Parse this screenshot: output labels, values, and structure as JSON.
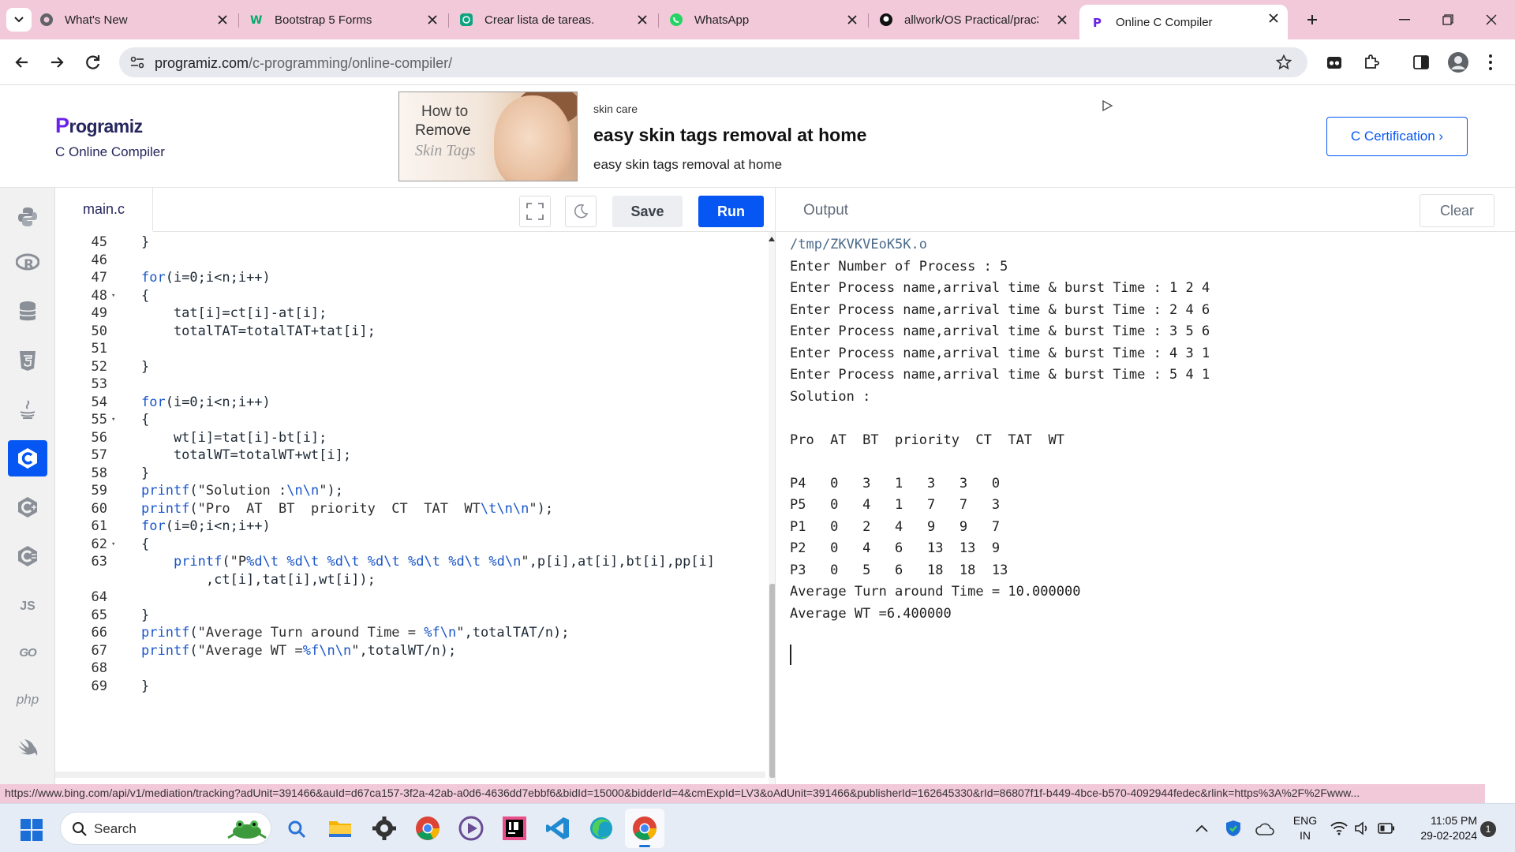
{
  "browser": {
    "tabs": [
      {
        "title": "What's New",
        "icon": "chrome-settings-icon"
      },
      {
        "title": "Bootstrap 5 Forms",
        "icon": "w3schools-icon"
      },
      {
        "title": "Crear lista de tareas.",
        "icon": "chatgpt-icon"
      },
      {
        "title": "WhatsApp",
        "icon": "whatsapp-icon"
      },
      {
        "title": "allwork/OS Practical/prac3",
        "icon": "github-icon"
      },
      {
        "title": "Online C Compiler",
        "icon": "programiz-icon"
      }
    ],
    "url_host": "programiz.com",
    "url_path": "/c-programming/online-compiler/"
  },
  "site": {
    "logo": "rogramiz",
    "logo_p": "P",
    "subtitle": "C Online Compiler",
    "certification_button": "C Certification ›"
  },
  "ad": {
    "image_line1": "How to",
    "image_line2": "Remove",
    "image_line3": "Skin Tags",
    "label": "skin care",
    "title": "easy skin tags removal at home",
    "description": "easy skin tags removal at home"
  },
  "languages": [
    "python",
    "r",
    "sql",
    "html",
    "java",
    "c",
    "cpp",
    "csharp",
    "js",
    "go",
    "php",
    "swift"
  ],
  "language_labels": {
    "js": "JS",
    "go": "GO",
    "php": "php"
  },
  "editor": {
    "filename": "main.c",
    "save_label": "Save",
    "run_label": "Run",
    "lines": [
      {
        "n": "45",
        "text": "}"
      },
      {
        "n": "46",
        "text": ""
      },
      {
        "n": "47",
        "text": "for(i=0;i<n;i++)"
      },
      {
        "n": "48",
        "text": "{",
        "fold": true
      },
      {
        "n": "49",
        "text": "    tat[i]=ct[i]-at[i];"
      },
      {
        "n": "50",
        "text": "    totalTAT=totalTAT+tat[i];"
      },
      {
        "n": "51",
        "text": ""
      },
      {
        "n": "52",
        "text": "}"
      },
      {
        "n": "53",
        "text": ""
      },
      {
        "n": "54",
        "text": "for(i=0;i<n;i++)"
      },
      {
        "n": "55",
        "text": "{",
        "fold": true
      },
      {
        "n": "56",
        "text": "    wt[i]=tat[i]-bt[i];"
      },
      {
        "n": "57",
        "text": "    totalWT=totalWT+wt[i];"
      },
      {
        "n": "58",
        "text": "}"
      },
      {
        "n": "59",
        "text": "printf(\"Solution :\\n\\n\");"
      },
      {
        "n": "60",
        "text": "printf(\"Pro  AT  BT  priority  CT  TAT  WT\\t\\n\\n\");"
      },
      {
        "n": "61",
        "text": "for(i=0;i<n;i++)"
      },
      {
        "n": "62",
        "text": "{",
        "fold": true
      },
      {
        "n": "63",
        "text": "    printf(\"P%d\\t %d\\t %d\\t %d\\t %d\\t %d\\t %d\\n\",p[i],at[i],bt[i],pp[i]"
      },
      {
        "n": "",
        "text": "        ,ct[i],tat[i],wt[i]);"
      },
      {
        "n": "64",
        "text": ""
      },
      {
        "n": "65",
        "text": "}"
      },
      {
        "n": "66",
        "text": "printf(\"Average Turn around Time = %f\\n\",totalTAT/n);"
      },
      {
        "n": "67",
        "text": "printf(\"Average WT =%f\\n\\n\",totalWT/n);"
      },
      {
        "n": "68",
        "text": ""
      },
      {
        "n": "69",
        "text": "}"
      }
    ]
  },
  "output": {
    "title": "Output",
    "clear_label": "Clear",
    "lines": [
      "/tmp/ZKVKVEoK5K.o",
      "Enter Number of Process : 5",
      "Enter Process name,arrival time & burst Time : 1 2 4",
      "Enter Process name,arrival time & burst Time : 2 4 6",
      "Enter Process name,arrival time & burst Time : 3 5 6",
      "Enter Process name,arrival time & burst Time : 4 3 1",
      "Enter Process name,arrival time & burst Time : 5 4 1",
      "Solution :",
      "",
      "Pro  AT  BT  priority  CT  TAT  WT",
      "",
      "P4   0   3   1   3   3   0",
      "P5   0   4   1   7   7   3",
      "P1   0   2   4   9   9   7",
      "P2   0   4   6   13  13  9",
      "P3   0   5   6   18  18  13",
      "Average Turn around Time = 10.000000",
      "Average WT =6.400000"
    ]
  },
  "status_url": "https://www.bing.com/api/v1/mediation/tracking?adUnit=391466&auId=d67ca157-3f2a-42ab-a0d6-4636dd7ebbf6&bidId=15000&bidderId=4&cmExpId=LV3&oAdUnit=391466&publisherId=162645330&rId=86807f1f-b449-4bce-b570-4092944fedec&rlink=https%3A%2F%2Fwww...",
  "taskbar": {
    "search_label": "Search",
    "language_line1": "ENG",
    "language_line2": "IN",
    "time": "11:05 PM",
    "date": "29-02-2024",
    "notification_count": "1"
  },
  "colors": {
    "accent": "#0556f3",
    "tabstrip": "#f2c9d8"
  }
}
